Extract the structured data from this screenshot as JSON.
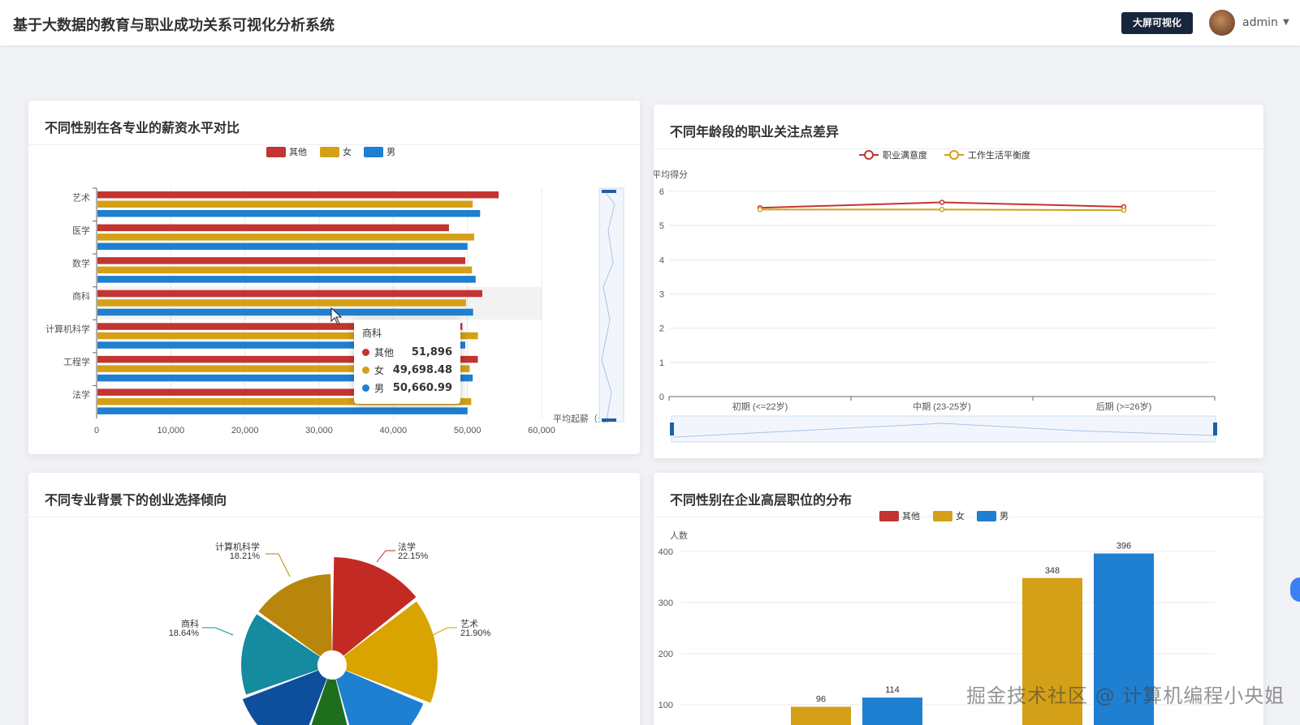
{
  "header": {
    "title": "基于大数据的教育与职业成功关系可视化分析系统",
    "screen_button": "大屏可视化",
    "user": "admin"
  },
  "colors": {
    "other": "#c23531",
    "female": "#d4a017",
    "male": "#1f7fd0",
    "satisfaction": "#c23531",
    "balance": "#d4a017"
  },
  "cards": {
    "salary": {
      "title": "不同性别在各专业的薪资水平对比"
    },
    "age": {
      "title": "不同年龄段的职业关注点差异"
    },
    "startup": {
      "title": "不同专业背景下的创业选择倾向"
    },
    "senior": {
      "title": "不同性别在企业高层职位的分布"
    }
  },
  "tooltip": {
    "title": "商科",
    "rows": [
      {
        "name": "其他",
        "value": "51,896"
      },
      {
        "name": "女",
        "value": "49,698.48"
      },
      {
        "name": "男",
        "value": "50,660.99"
      }
    ]
  },
  "watermark": "掘金技术社区 @ 计算机编程小央姐",
  "chart_data": [
    {
      "type": "bar",
      "orientation": "horizontal",
      "categories": [
        "艺术",
        "医学",
        "数学",
        "商科",
        "计算机科学",
        "工程学",
        "法学"
      ],
      "series": [
        {
          "name": "其他",
          "values": [
            54100,
            47400,
            49600,
            51896,
            49200,
            51300,
            46400
          ]
        },
        {
          "name": "女",
          "values": [
            50600,
            50800,
            50500,
            49698.48,
            51300,
            50200,
            50400
          ]
        },
        {
          "name": "男",
          "values": [
            51600,
            49900,
            51000,
            50660.99,
            49600,
            50600,
            49900
          ]
        }
      ],
      "xlim": [
        0,
        60000
      ],
      "x_ticks": [
        "0",
        "10,000",
        "20,000",
        "30,000",
        "40,000",
        "50,000",
        "60,000"
      ],
      "xlabel": "平均起薪（元）",
      "legend": "top-center"
    },
    {
      "type": "line",
      "categories": [
        "初期 (<=22岁)",
        "中期 (23-25岁)",
        "后期 (>=26岁)"
      ],
      "series": [
        {
          "name": "职业满意度",
          "values": [
            5.52,
            5.68,
            5.55
          ]
        },
        {
          "name": "工作生活平衡度",
          "values": [
            5.47,
            5.47,
            5.45
          ]
        }
      ],
      "ylabel": "平均得分",
      "ylim": [
        0,
        6
      ],
      "y_ticks": [
        "0",
        "1",
        "2",
        "3",
        "4",
        "5",
        "6"
      ],
      "legend": "top-center"
    },
    {
      "type": "pie",
      "variant": "rose",
      "slices": [
        {
          "name": "法学",
          "percent": "22.15%"
        },
        {
          "name": "艺术",
          "percent": "21.90%"
        },
        {
          "name": "商科",
          "percent": "18.64%"
        },
        {
          "name": "计算机科学",
          "percent": "18.21%"
        }
      ]
    },
    {
      "type": "bar",
      "ylabel": "人数",
      "y_ticks": [
        "100",
        "200",
        "300",
        "400"
      ],
      "ylim": [
        100,
        400
      ],
      "legend_items": [
        "其他",
        "女",
        "男"
      ],
      "bars": [
        {
          "series": "女",
          "group": 1,
          "value": 96
        },
        {
          "series": "男",
          "group": 1,
          "value": 114
        },
        {
          "series": "女",
          "group": 2,
          "value": 348
        },
        {
          "series": "男",
          "group": 2,
          "value": 396
        }
      ]
    }
  ]
}
